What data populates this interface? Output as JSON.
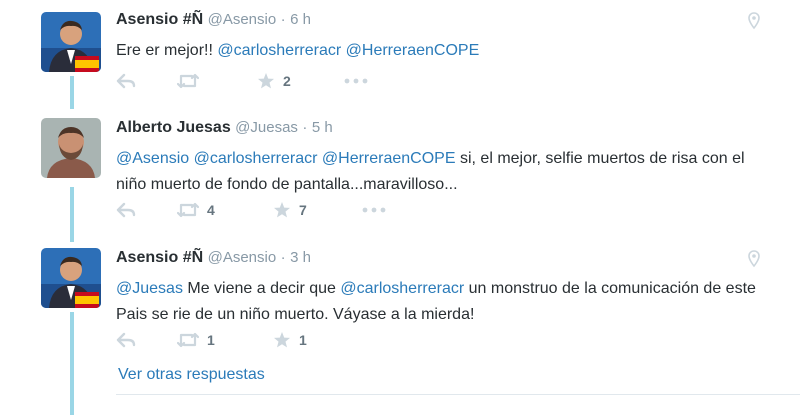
{
  "tweets": [
    {
      "fullname": "Asensio #Ñ",
      "handle": "@Asensio",
      "time": "6 h",
      "text": [
        {
          "t": "Ere er mejor!! ",
          "m": false
        },
        {
          "t": "@carlosherreracr",
          "m": true
        },
        {
          "t": " ",
          "m": false
        },
        {
          "t": "@HerreraenCOPE",
          "m": true
        }
      ],
      "retweets": "",
      "likes": "2",
      "has_geo": true
    },
    {
      "fullname": "Alberto Juesas",
      "handle": "@Juesas",
      "time": "5 h",
      "text": [
        {
          "t": "@Asensio",
          "m": true
        },
        {
          "t": " ",
          "m": false
        },
        {
          "t": "@carlosherreracr",
          "m": true
        },
        {
          "t": " ",
          "m": false
        },
        {
          "t": "@HerreraenCOPE",
          "m": true
        },
        {
          "t": " si, el mejor, selfie muertos de risa con el niño muerto de fondo de pantalla...maravilloso...",
          "m": false
        }
      ],
      "retweets": "4",
      "likes": "7",
      "has_geo": false
    },
    {
      "fullname": "Asensio #Ñ",
      "handle": "@Asensio",
      "time": "3 h",
      "text": [
        {
          "t": "@Juesas",
          "m": true
        },
        {
          "t": " Me viene a decir que ",
          "m": false
        },
        {
          "t": "@carlosherreracr",
          "m": true
        },
        {
          "t": " un monstruo de la comunicación de este Pais se rie de un niño muerto. Váyase a la mierda!",
          "m": false
        }
      ],
      "retweets": "1",
      "likes": "1",
      "has_geo": true
    }
  ],
  "separator": "·",
  "more_replies": "Ver otras respuestas",
  "icons": {
    "reply": "reply-icon",
    "retweet": "retweet-icon",
    "like": "star-icon",
    "more": "more-icon",
    "geo": "location-pin-icon"
  },
  "colors": {
    "link": "#2b7bb9",
    "muted": "#8899a6",
    "icon": "#ccd6dd",
    "thread": "#9ad6e6"
  }
}
